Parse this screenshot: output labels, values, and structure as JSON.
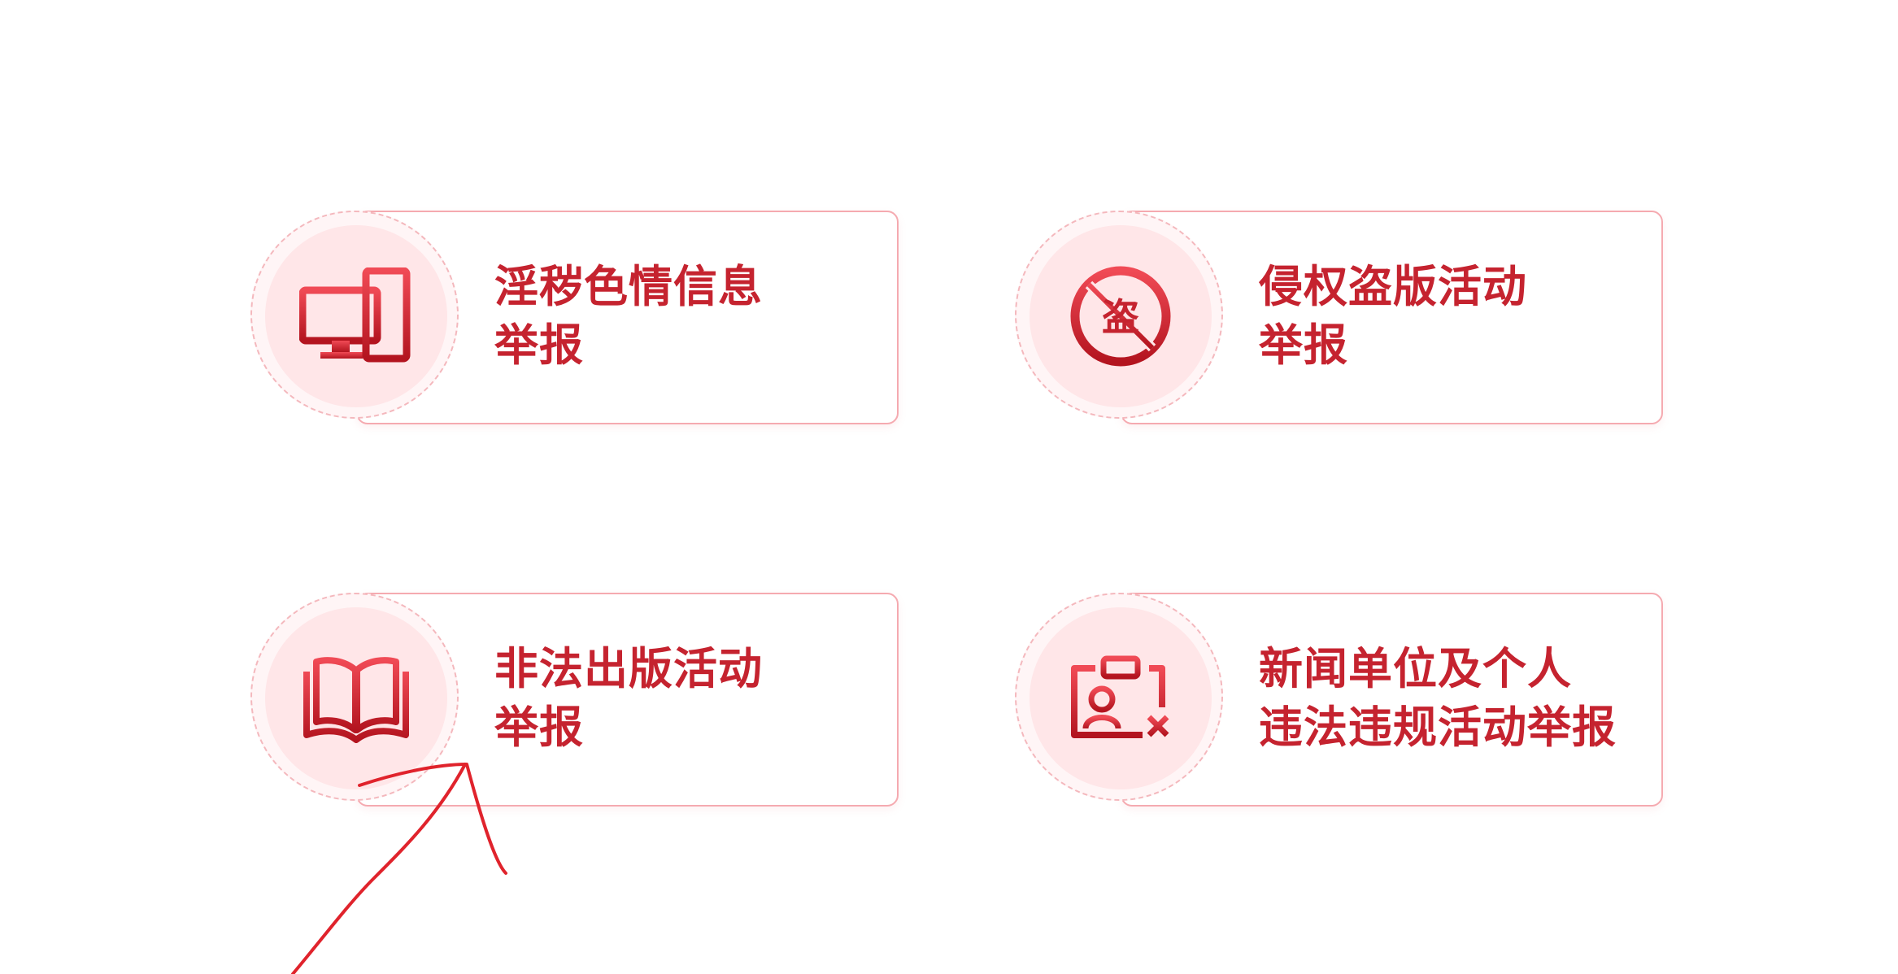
{
  "accent_color": "#c5232f",
  "cards": [
    {
      "id": "porn",
      "icon": "computer-monitor-icon",
      "line1": "淫秽色情信息",
      "line2": "举报"
    },
    {
      "id": "piracy",
      "icon": "no-piracy-icon",
      "icon_text": "盗",
      "line1": "侵权盗版活动",
      "line2": "举报"
    },
    {
      "id": "illegal-publishing",
      "icon": "open-book-icon",
      "line1": "非法出版活动",
      "line2": "举报"
    },
    {
      "id": "news-violation",
      "icon": "id-card-violation-icon",
      "line1": "新闻单位及个人",
      "line2": "违法违规活动举报"
    }
  ]
}
